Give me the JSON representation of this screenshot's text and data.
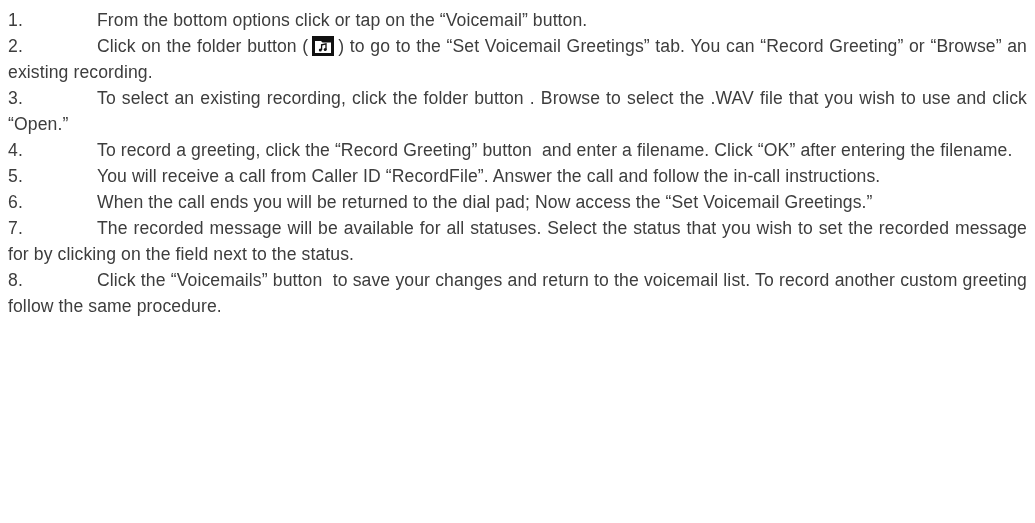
{
  "steps": [
    {
      "kind": "plain",
      "number": "1.",
      "text": "From the bottom options click or tap on the “Voicemail” button."
    },
    {
      "kind": "with-icon",
      "number": "2.",
      "text": "Click on the folder button (",
      "text_after": ") to go to the “Set Voicemail Greetings” tab. You can “Record Greeting” or “Browse” an existing recording."
    },
    {
      "kind": "plain",
      "number": "3.",
      "text": "To select an existing recording, click the folder button . Browse to select the .WAV file that you wish to use and click “Open.”"
    },
    {
      "kind": "plain",
      "number": "4.",
      "text": "To record a greeting, click the “Record Greeting” button  and enter a filename. Click “OK” after entering the filename."
    },
    {
      "kind": "plain",
      "number": "5.",
      "text": "You will receive a call from Caller ID “RecordFile”. Answer the call and follow the in-call instructions."
    },
    {
      "kind": "plain",
      "number": "6.",
      "text": "When the call ends you will be returned to the dial pad; Now access the “Set Voicemail Greetings.”"
    },
    {
      "kind": "plain",
      "number": "7.",
      "text": "The recorded message will be available for all statuses. Select the status that you wish to set the recorded message for by clicking on the field next to the status."
    },
    {
      "kind": "plain",
      "number": "8.",
      "text": "Click the “Voicemails” button  to save your changes and return to the voicemail list. To record another custom greeting follow the same procedure."
    }
  ]
}
